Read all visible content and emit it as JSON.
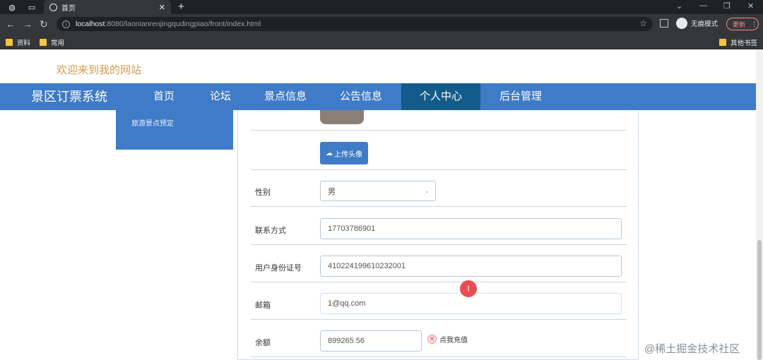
{
  "browser": {
    "tab_title": "首页",
    "tab_close": "✕",
    "new_tab": "+",
    "url_host": "localhost",
    "url_rest": ":8080/laonianrenjingqudingpiao/front/index.html",
    "incognito_label": "无痕模式",
    "update_label": "更新",
    "bookmarks": [
      "资料",
      "常用"
    ],
    "other_bookmarks": "其他书签",
    "window_controls": [
      "⌄",
      "—",
      "❐",
      "✕"
    ]
  },
  "site": {
    "welcome": "欢迎来到我的网站",
    "brand": "景区订票系统",
    "nav": [
      {
        "label": "首页"
      },
      {
        "label": "论坛"
      },
      {
        "label": "景点信息"
      },
      {
        "label": "公告信息"
      },
      {
        "label": "个人中心"
      },
      {
        "label": "后台管理"
      }
    ],
    "sidemenu_item": "旅游景点预定"
  },
  "form": {
    "upload_label": "上传头像",
    "gender_label": "性别",
    "gender_value": "男",
    "phone_label": "联系方式",
    "phone_value": "17703786901",
    "idcard_label": "用户身份证号",
    "idcard_value": "410224199610232001",
    "email_label": "邮箱",
    "email_value": "1@qq.com",
    "balance_label": "余额",
    "balance_value": "899265.56",
    "recharge_label": "点我充值"
  },
  "overlay": {
    "cursor_marker": "I",
    "watermark": "@稀土掘金技术社区"
  },
  "icons": [
    "globe-icon",
    "back-icon",
    "forward-icon",
    "reload-icon",
    "info-icon",
    "star-icon",
    "sidepanel-icon",
    "cloud-upload-icon",
    "close-circle-icon",
    "folder-icon"
  ],
  "colors": {
    "nav_bg": "#3f7bc6",
    "nav_active": "#135c8a",
    "welcome": "#d39a4d"
  }
}
